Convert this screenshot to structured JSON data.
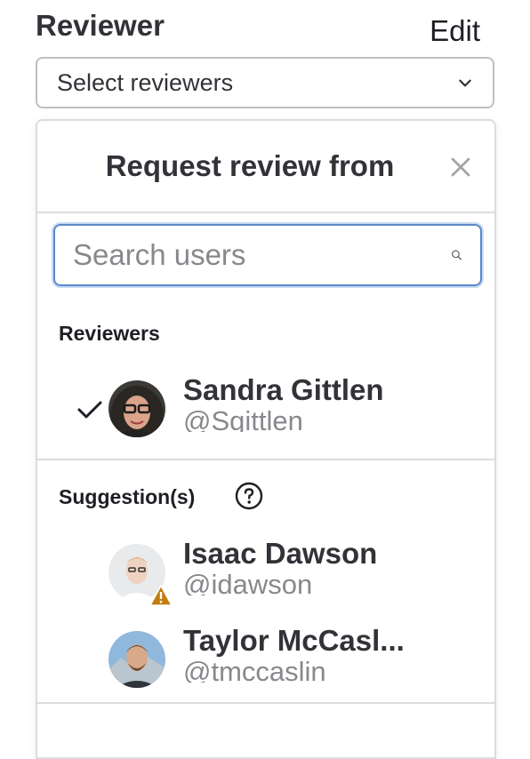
{
  "sidebar": {
    "heading": "Reviewer",
    "edit_label": "Edit",
    "select_placeholder": "Select reviewers"
  },
  "dropdown": {
    "title": "Request review from",
    "search_placeholder": "Search users",
    "reviewers_section_label": "Reviewers",
    "reviewers": [
      {
        "name": "Sandra Gittlen",
        "handle": "@Sgittlen",
        "selected": true
      }
    ],
    "suggestions_section_label": "Suggestion(s)",
    "suggestions": [
      {
        "name": "Isaac Dawson",
        "handle": "@idawson",
        "warning": true
      },
      {
        "name": "Taylor McCasl...",
        "handle": "@tmccaslin",
        "warning": false
      }
    ]
  },
  "colors": {
    "focus_border": "#5b88c7",
    "warning": "#c17d10",
    "muted_text": "#89888d"
  }
}
